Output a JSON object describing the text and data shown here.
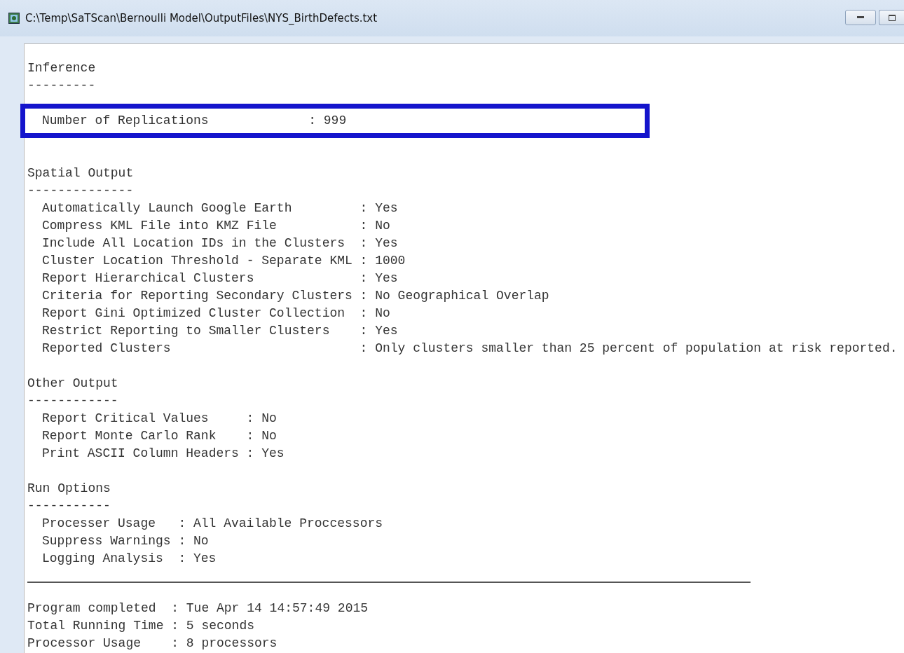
{
  "window": {
    "title": "C:\\Temp\\SaTScan\\Bernoulli Model\\OutputFiles\\NYS_BirthDefects.txt"
  },
  "sections": [
    {
      "title": "Inference",
      "underline": "---------",
      "rows": [
        {
          "key": "Number of Replications",
          "value": ": 999",
          "highlighted": true
        }
      ]
    },
    {
      "title": "Spatial Output",
      "underline": "--------------",
      "rows": [
        {
          "key": "Automatically Launch Google Earth",
          "value": ": Yes",
          "highlighted": false
        },
        {
          "key": "Compress KML File into KMZ File",
          "value": ": No",
          "highlighted": false
        },
        {
          "key": "Include All Location IDs in the Clusters",
          "value": ": Yes",
          "highlighted": false
        },
        {
          "key": "Cluster Location Threshold - Separate KML",
          "value": ": 1000",
          "highlighted": false
        },
        {
          "key": "Report Hierarchical Clusters",
          "value": ": Yes",
          "highlighted": false
        },
        {
          "key": "Criteria for Reporting Secondary Clusters",
          "value": ": No Geographical Overlap",
          "highlighted": false
        },
        {
          "key": "Report Gini Optimized Cluster Collection",
          "value": ": No",
          "highlighted": false
        },
        {
          "key": "Restrict Reporting to Smaller Clusters",
          "value": ": Yes",
          "highlighted": false
        },
        {
          "key": "Reported Clusters",
          "value": ": Only clusters smaller than 25 percent of population at risk reported.",
          "highlighted": false
        }
      ]
    },
    {
      "title": "Other Output",
      "underline": "------------",
      "rows": [
        {
          "key": "Report Critical Values",
          "value": ": No",
          "highlighted": false
        },
        {
          "key": "Report Monte Carlo Rank",
          "value": ": No",
          "highlighted": false
        },
        {
          "key": "Print ASCII Column Headers",
          "value": ": Yes",
          "highlighted": false
        }
      ]
    },
    {
      "title": "Run Options",
      "underline": "-----------",
      "rows": [
        {
          "key": "Processer Usage",
          "value": ": All Available Proccessors",
          "highlighted": false
        },
        {
          "key": "Suppress Warnings",
          "value": ": No",
          "highlighted": false
        },
        {
          "key": "Logging Analysis",
          "value": ": Yes",
          "highlighted": false
        }
      ]
    }
  ],
  "summary": [
    {
      "key": "Program completed",
      "value": ": Tue Apr 14 14:57:49 2015"
    },
    {
      "key": "Total Running Time",
      "value": ": 5 seconds"
    },
    {
      "key": "Processor Usage",
      "value": ": 8 processors"
    }
  ]
}
